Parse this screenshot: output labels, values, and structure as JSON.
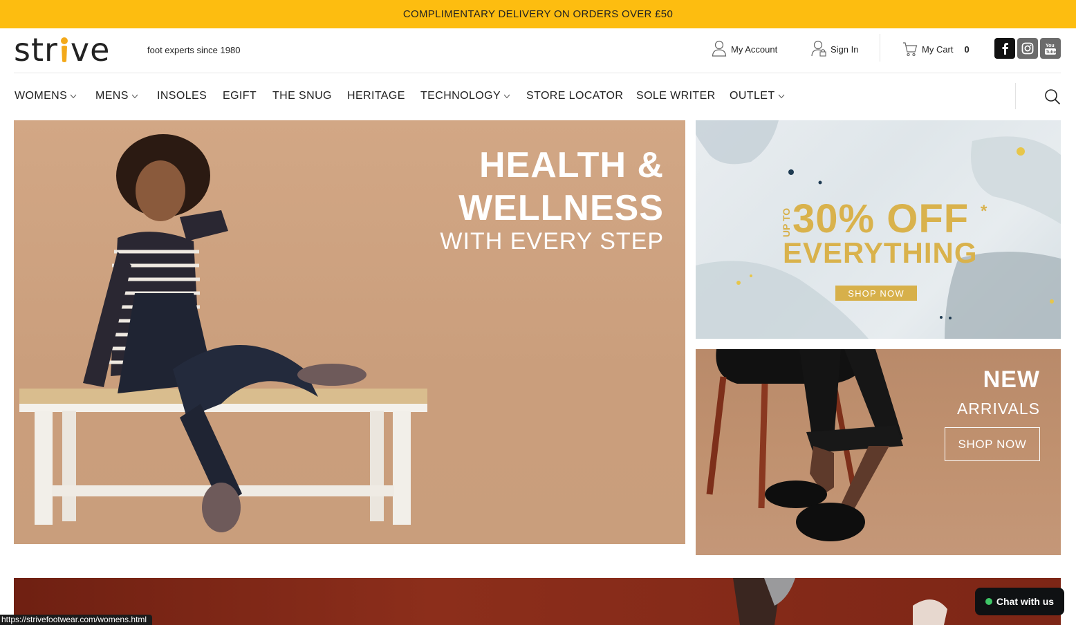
{
  "promo_bar": {
    "text": "COMPLIMENTARY DELIVERY ON ORDERS OVER £50"
  },
  "header": {
    "logo_text_before": "str",
    "logo_text_after": "ve",
    "tagline": "foot experts since 1980",
    "my_account": "My Account",
    "sign_in": "Sign In",
    "my_cart": "My Cart",
    "cart_count": "0",
    "social": [
      "facebook-icon",
      "instagram-icon",
      "youtube-icon"
    ]
  },
  "nav": {
    "items": [
      {
        "label": "WOMENS",
        "dropdown": true
      },
      {
        "label": "MENS",
        "dropdown": true
      },
      {
        "label": "INSOLES",
        "dropdown": false
      },
      {
        "label": "EGIFT",
        "dropdown": false
      },
      {
        "label": "THE SNUG",
        "dropdown": false
      },
      {
        "label": "HERITAGE",
        "dropdown": false
      },
      {
        "label": "TECHNOLOGY",
        "dropdown": true
      },
      {
        "label": "STORE LOCATOR",
        "dropdown": false
      },
      {
        "label": "SOLE WRITER",
        "dropdown": false
      },
      {
        "label": "OUTLET",
        "dropdown": true
      }
    ]
  },
  "hero": {
    "title_line1": "HEALTH &",
    "title_line2": "WELLNESS",
    "subtitle": "WITH EVERY STEP"
  },
  "promo_tile": {
    "up_to": "UP TO",
    "headline": "30% OFF",
    "star": "*",
    "line2": "EVERYTHING",
    "button": "SHOP NOW"
  },
  "arrivals_tile": {
    "new": "NEW",
    "arrivals": "ARRIVALS",
    "button": "SHOP NOW"
  },
  "status_url": "https://strivefootwear.com/womens.html",
  "chat": {
    "label": "Chat with us"
  },
  "colors": {
    "promo_bar": "#fdbd10",
    "gold": "#d9b24c",
    "chat_dot": "#3fc667"
  }
}
